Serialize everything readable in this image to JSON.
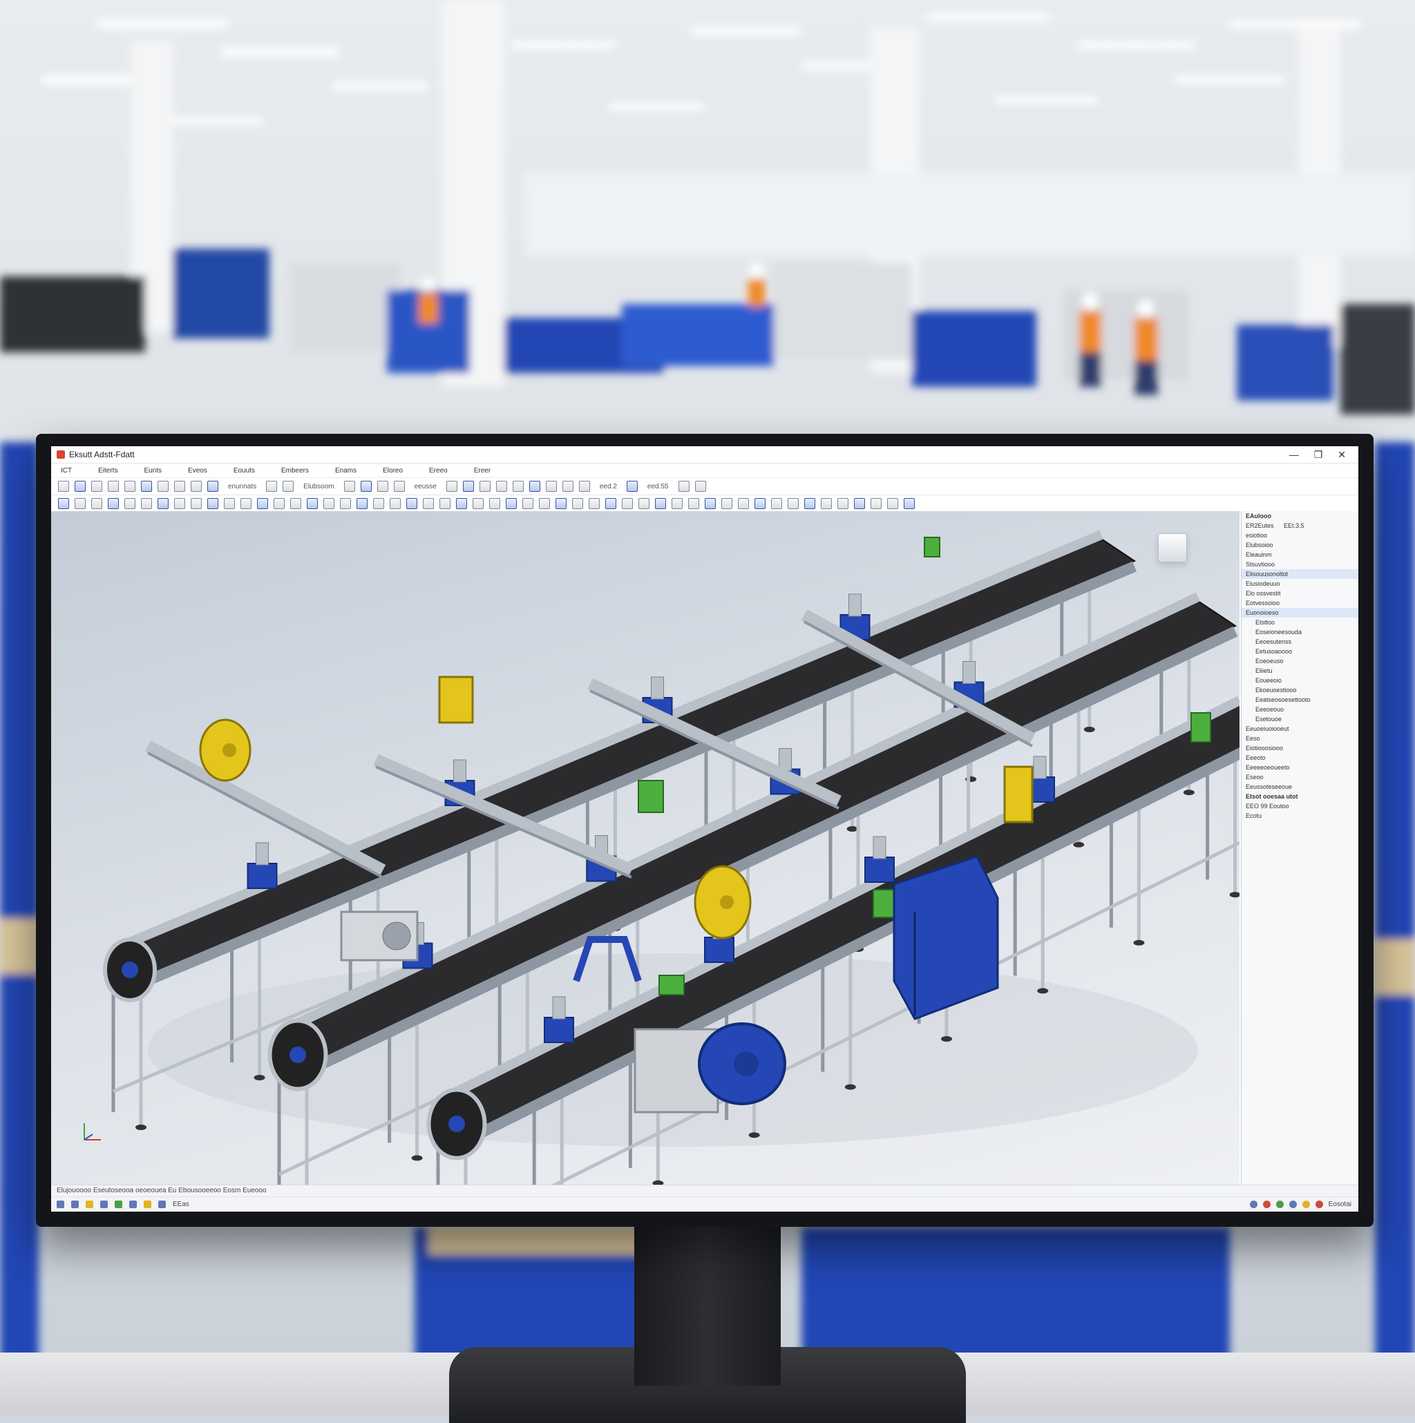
{
  "window": {
    "title": "Eksutt Adstt-Fdatt",
    "controls": [
      "—",
      "❐",
      "✕"
    ]
  },
  "menu": [
    "ICT",
    "Eiterts",
    "Eunts",
    "Eveos",
    "Eouuts",
    "Embeers",
    "Enams",
    "Eloreo",
    "Ereeo",
    "Ereer"
  ],
  "toolbar": {
    "row1_text": [
      "enunnats",
      "Elubsoom",
      "eeusse",
      "eed.2",
      "eed.55"
    ],
    "row1_icon_count": 28,
    "row2_icon_count": 52
  },
  "side_panel": {
    "title": "EAulooo",
    "header_values": [
      "ER2Eutes",
      "EEt.3.5"
    ],
    "rows": [
      {
        "text": "esiotioo",
        "selected": false,
        "bold": false
      },
      {
        "text": "Elubsoioo",
        "selected": false,
        "bold": false
      },
      {
        "text": "Eleauinm",
        "selected": false,
        "bold": false
      },
      {
        "text": "Stsuvtiooo",
        "selected": false,
        "bold": false
      },
      {
        "text": "Elisouusonoltot",
        "selected": true,
        "bold": false
      },
      {
        "text": "Elusiodeuuo",
        "selected": false,
        "bold": false
      },
      {
        "text": "Elo ossvestit",
        "selected": false,
        "bold": false
      },
      {
        "text": "Eotvessoioo",
        "selected": false,
        "bold": false
      },
      {
        "text": "Euonoioeso",
        "selected": true,
        "bold": false
      },
      {
        "text": "Etsttoo",
        "selected": false,
        "bold": false
      },
      {
        "text": "Eoseioneesouda",
        "selected": false,
        "bold": false
      },
      {
        "text": "Eeoesutenss",
        "selected": false,
        "bold": false
      },
      {
        "text": "Eetusoaoooo",
        "selected": false,
        "bold": false
      },
      {
        "text": "Eoeoeuso",
        "selected": false,
        "bold": false
      },
      {
        "text": "Eliietu",
        "selected": false,
        "bold": false
      },
      {
        "text": "Eoueeoio",
        "selected": false,
        "bold": false
      },
      {
        "text": "Ekoeuoestiooo",
        "selected": false,
        "bold": false
      },
      {
        "text": "Eeatseosoesettooto",
        "selected": false,
        "bold": false
      },
      {
        "text": "Eeeoeouo",
        "selected": false,
        "bold": false
      },
      {
        "text": "Esetouoe",
        "selected": false,
        "bold": false
      },
      {
        "text": "Eeuoeiuoiooeut",
        "selected": false,
        "bold": false
      },
      {
        "text": "Eeso",
        "selected": false,
        "bold": false
      },
      {
        "text": "Eiotiooosiooo",
        "selected": false,
        "bold": false
      },
      {
        "text": "Eeeoto",
        "selected": false,
        "bold": false
      },
      {
        "text": "Eeeeeoeoueeto",
        "selected": false,
        "bold": false
      },
      {
        "text": "Eseoo",
        "selected": false,
        "bold": false
      },
      {
        "text": "Eeussoteseeoue",
        "selected": false,
        "bold": false
      },
      {
        "text": "Etsot ooesaa utot",
        "selected": false,
        "bold": true
      },
      {
        "text": "EEO 99 Eoutoo",
        "selected": false,
        "bold": false
      },
      {
        "text": "Ecotu",
        "selected": false,
        "bold": false
      }
    ]
  },
  "status": {
    "line1": "Elujouoooo Eseutoseooa oeoeouea Eu Ebousooeeoo Eosm Eueooo",
    "zoom_label": "EEas",
    "right_label": "Eosotai"
  },
  "colors": {
    "frame": "#b9c0c8",
    "frame_dark": "#8d96a1",
    "belt": "#2b2b2d",
    "blue": "#2447b5",
    "yellow": "#e3c51b",
    "green": "#4caf3d"
  },
  "icons": {
    "app": "app-logo-icon",
    "view_cube": "view-cube-icon",
    "triad": "axis-triad-icon"
  }
}
